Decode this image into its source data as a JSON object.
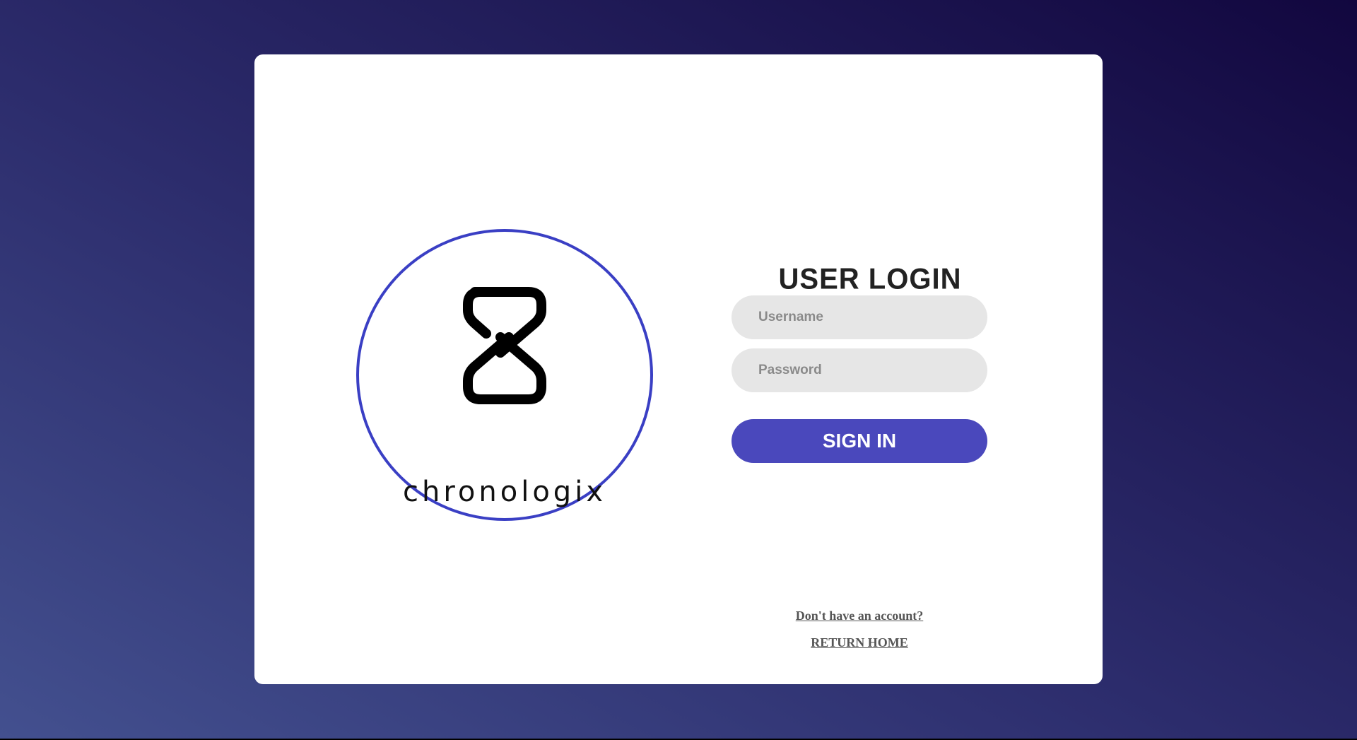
{
  "brand": {
    "name": "chronologix",
    "accent_color": "#3a3fc4",
    "logo_icon": "hourglass-s-icon"
  },
  "login": {
    "title": "USER LOGIN",
    "username_placeholder": "Username",
    "password_placeholder": "Password",
    "signin_label": "SIGN IN",
    "signin_color": "#4a48bc"
  },
  "links": {
    "signup": "Don't have an account?",
    "return_home": "RETURN HOME"
  }
}
